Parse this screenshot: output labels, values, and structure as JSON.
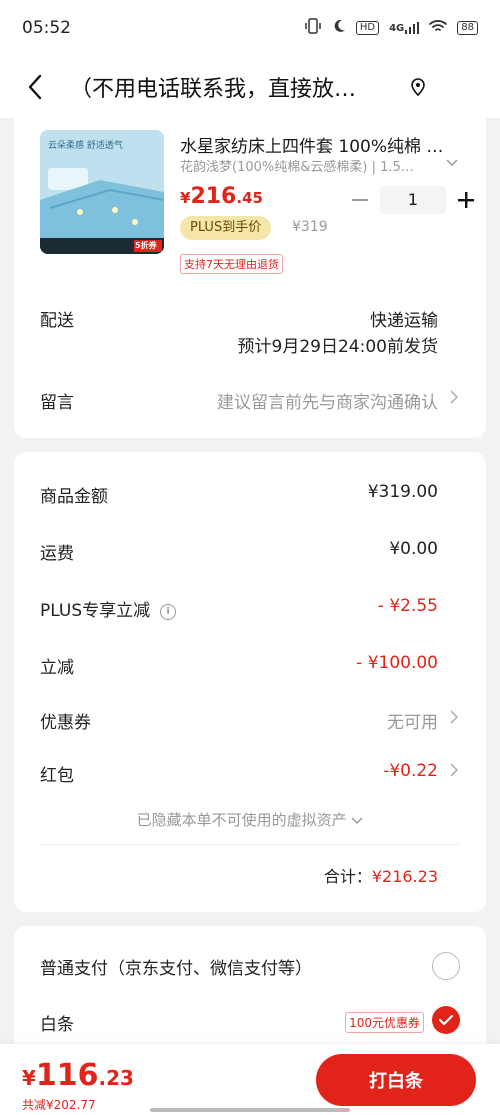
{
  "status_bar": {
    "time": "05:52",
    "hd": "HD",
    "network": "4G",
    "battery": "88"
  },
  "header": {
    "address": "（不用电话联系我，直接放…",
    "back_icon": "chevron-left-icon",
    "location_icon": "location-pin-icon"
  },
  "product": {
    "title": "水星家纺床上四件套 100%纯棉 …",
    "spec": "花韵浅梦(100%纯棉&云感棉柔) | 1.5…",
    "price_currency": "¥",
    "price_int": "216",
    "price_dec": ".45",
    "quantity": "1",
    "plus_badge": "PLUS到手价",
    "original_price": "¥319",
    "return_policy": "支持7天无理由退货",
    "image_banner_text": "云朵柔感 舒适透气",
    "image_coupon_text": "5折券"
  },
  "delivery": {
    "label": "配送",
    "method": "快递运输",
    "eta": "预计9月29日24:00前发货"
  },
  "message": {
    "label": "留言",
    "placeholder": "建议留言前先与商家沟通确认"
  },
  "summary": {
    "goods_label": "商品金额",
    "goods_value": "¥319.00",
    "shipping_label": "运费",
    "shipping_value": "¥0.00",
    "plus_discount_label": "PLUS专享立减",
    "plus_discount_value": "- ¥2.55",
    "discount_label": "立减",
    "discount_value": "- ¥100.00",
    "coupon_label": "优惠券",
    "coupon_value": "无可用",
    "redpacket_label": "红包",
    "redpacket_value": "-¥0.22",
    "hidden_assets": "已隐藏本单不可使用的虚拟资产",
    "total_label": "合计：",
    "total_value": "¥216.23"
  },
  "payment": {
    "normal_label": "普通支付（京东支付、微信支付等）",
    "baitiao_label": "白条",
    "baitiao_coupon": "100元优惠券"
  },
  "bottom_bar": {
    "currency": "¥",
    "total_int": "116",
    "total_dec": ".23",
    "savings": "共减¥202.77",
    "pay_button": "打白条"
  },
  "colors": {
    "accent": "#e2231a",
    "background": "#f2f2f2",
    "plus_badge_bg": "#f6e5a8"
  }
}
